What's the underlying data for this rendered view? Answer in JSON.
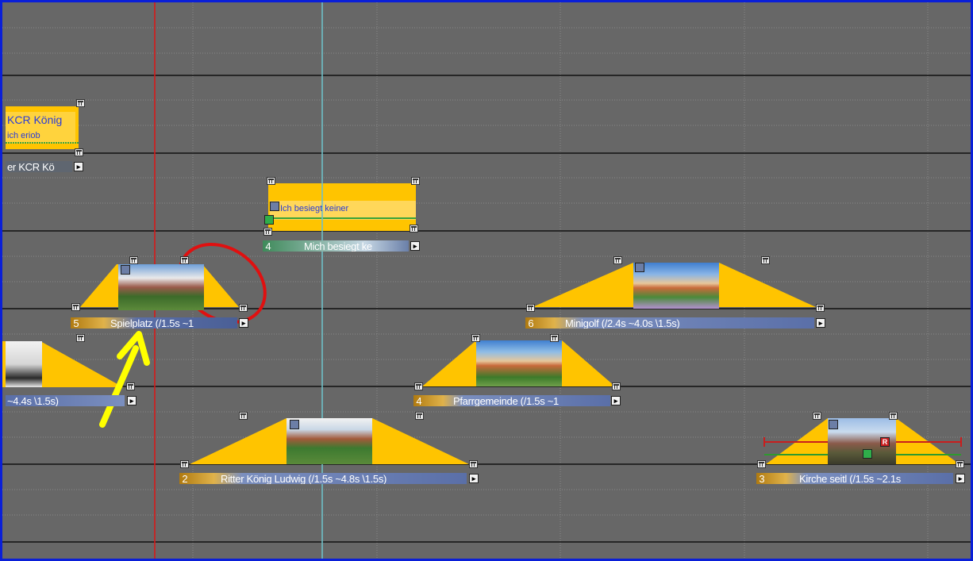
{
  "colors": {
    "background": "#676767",
    "frame_border": "#0a1fd8",
    "clip_fill": "#ffc400",
    "label_orange": "#b07a10",
    "label_blue": "#5a6fa8",
    "label_green": "#3f8a5a",
    "playhead_red": "#d81818",
    "cursor_cyan": "#6ec0c8",
    "annotation_ellipse": "#e01010",
    "annotation_arrow": "#ffff00"
  },
  "clips": [
    {
      "id": "koenig-text",
      "label": "er KCR Kö",
      "title_text": "KCR König",
      "subtitle_text": "ich eriob",
      "number": ""
    },
    {
      "id": "mich-besiegt",
      "label": "Mich besiegt ke",
      "title_text": "Ich besiegt keiner",
      "number": "4"
    },
    {
      "id": "spielplatz",
      "label": "Spielplatz (/1.5s ~1",
      "number": "5"
    },
    {
      "id": "minigolf",
      "label": "Minigolf (/2.4s ~4.0s \\1.5s)",
      "number": "6"
    },
    {
      "id": "left-cut",
      "label": "~4.4s \\1.5s)",
      "number": ""
    },
    {
      "id": "pfarrgemeinde",
      "label": "Pfarrgemeinde (/1.5s ~1",
      "number": "4"
    },
    {
      "id": "ritter",
      "label": "Ritter König Ludwig (/1.5s ~4.8s \\1.5s)",
      "number": "2"
    },
    {
      "id": "kirche",
      "label": "Kirche seitl (/1.5s ~2.1s",
      "number": "3"
    }
  ],
  "icons": {
    "arrow_button": "▸",
    "marker_r": "R"
  }
}
